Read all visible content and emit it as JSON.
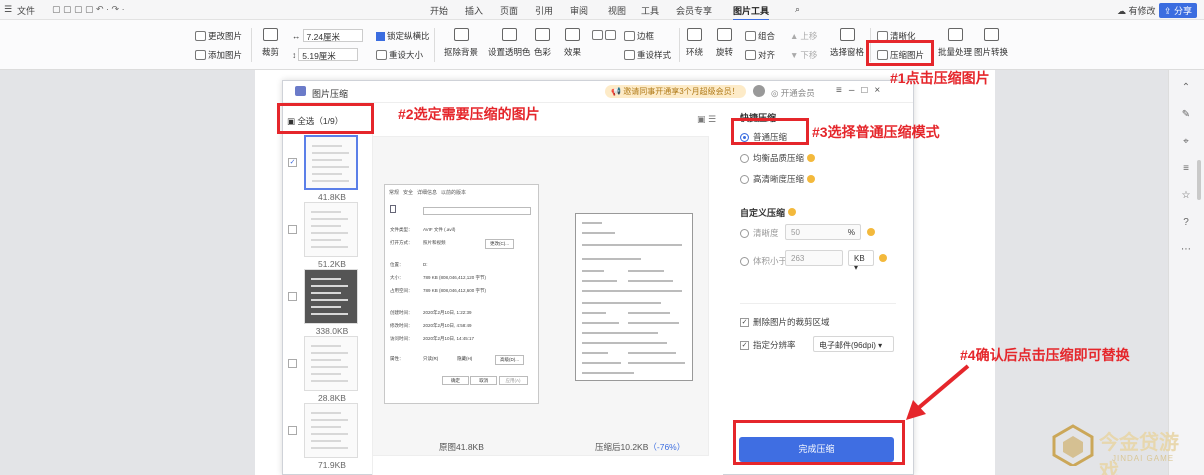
{
  "topbar": {
    "file_menu": "文件",
    "tabs": [
      "开始",
      "插入",
      "页面",
      "引用",
      "审阅",
      "视图",
      "工具",
      "会员专享",
      "图片工具"
    ],
    "active_tab": "图片工具",
    "changes": "有修改",
    "share": "分享"
  },
  "ribbon": {
    "change_image": "更改图片",
    "add_image": "添加图片",
    "crop": "裁剪",
    "width": "7.24厘米",
    "height": "5.19厘米",
    "lock_ratio": "锁定纵横比",
    "reset_size": "重设大小",
    "remove_bg": "抠除背景",
    "set_transparent": "设置透明色",
    "color": "色彩",
    "effect": "效果",
    "border": "边框",
    "reset_style": "重设样式",
    "wrap": "环绕",
    "rotate": "旋转",
    "group": "组合",
    "align": "对齐",
    "move_up": "上移",
    "move_down": "下移",
    "select_pane": "选择窗格",
    "sharpen": "清晰化",
    "compress": "压缩图片",
    "batch": "批量处理",
    "convert": "图片转换"
  },
  "dialog": {
    "title": "图片压缩",
    "promo": "邀请同事开通享3个月超级会员！",
    "vip": "开通会员",
    "select_all": "全选（1/9）",
    "thumbs": [
      {
        "size": "41.8KB",
        "checked": true
      },
      {
        "size": "51.2KB",
        "checked": false
      },
      {
        "size": "338.0KB",
        "checked": false
      },
      {
        "size": "28.8KB",
        "checked": false
      },
      {
        "size": "71.9KB",
        "checked": false
      }
    ],
    "preview": {
      "original": "原图41.8KB",
      "compressed": "压缩后10.2KB",
      "ratio": "（-76%）"
    },
    "orig_window": {
      "tabs": [
        "常规",
        "安全",
        "详细信息",
        "以前的版本"
      ],
      "fields": [
        "文件类型：",
        "打开方式：",
        "位置：",
        "大小：",
        "占用空间：",
        "创建时间：",
        "修改时间：",
        "访问时间：",
        "属性："
      ],
      "values": [
        "AVIF 文件 (.avif)",
        "照片和视频",
        "D:",
        "789 KB (808,046,412,120 字节)",
        "789 KB (808,046,412,600 字节)",
        "2020年2月10日, 1:22:39",
        "2020年2月10日, 4:58:49",
        "2020年2月10日, 14:45:17"
      ],
      "change": "更改(C)...",
      "readonly": "只读(R)",
      "hidden": "隐藏(H)",
      "advanced": "高级(D)...",
      "ok": "确定",
      "cancel": "取消",
      "apply": "应用(A)"
    },
    "quick_title": "快捷压缩",
    "modes": [
      "普通压缩",
      "均衡品质压缩",
      "高清晰度压缩"
    ],
    "custom_title": "自定义压缩",
    "clarity": "清晰度",
    "clarity_val": "50",
    "clarity_unit": "%",
    "size_lt": "体积小于",
    "size_val": "263",
    "size_unit": "KB",
    "delete_crop": "删除图片的裁剪区域",
    "resolution": "指定分辨率",
    "resolution_val": "电子邮件(96dpi)",
    "done": "完成压缩"
  },
  "annotations": [
    "#1点击压缩图片",
    "#2选定需要压缩的图片",
    "#3选择普通压缩模式",
    "#4确认后点击压缩即可替换"
  ],
  "watermark": {
    "brand": "今金贷游戏",
    "sub": "JINDAI GAME"
  },
  "colors": {
    "accent": "#3b6de0",
    "annotation": "#e5262b"
  }
}
